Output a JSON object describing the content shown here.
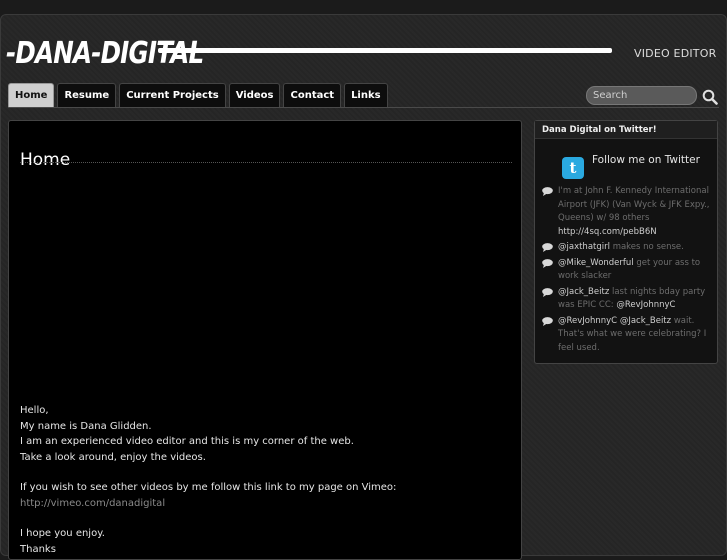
{
  "header": {
    "logo_text": "-DANA-DIGITAL",
    "tagline": "VIDEO EDITOR"
  },
  "nav": {
    "tabs": [
      "Home",
      "Resume",
      "Current Projects",
      "Videos",
      "Contact",
      "Links"
    ],
    "active": "Home"
  },
  "search": {
    "placeholder": "Search"
  },
  "main": {
    "title": "Home",
    "paragraphs": {
      "p1": [
        "Hello,",
        "My name is Dana Glidden.",
        "I am an experienced video editor and this is my corner of the web.",
        "Take a look around, enjoy the videos."
      ],
      "p2_text": "If you wish to see other videos by me follow this link to my page on Vimeo:",
      "p2_link": "http://vimeo.com/danadigital",
      "p3": "I hope you enjoy.",
      "p4": "Thanks"
    }
  },
  "sidebar": {
    "title": "Dana Digital on Twitter!",
    "follow_label": "Follow me on Twitter",
    "tweets": [
      {
        "mention": "",
        "text": "I'm at John F. Kennedy International Airport (JFK) (Van Wyck & JFK Expy., Queens) w/ 98 others",
        "link": "http://4sq.com/pebB6N"
      },
      {
        "mention": "@jaxthatgirl",
        "text": "makes no sense.",
        "link": ""
      },
      {
        "mention": "@Mike_Wonderful",
        "text": "get your ass to work slacker",
        "link": ""
      },
      {
        "mention": "@Jack_Beitz",
        "text": "last nights bday party was EPIC CC:",
        "link": "@RevJohnnyC"
      },
      {
        "mention": "@RevJohnnyC @Jack_Beitz",
        "text": "wait. That's what we were celebrating? I feel used.",
        "link": ""
      }
    ]
  },
  "colors": {
    "background": "#262626",
    "content_bg": "#000000",
    "twitter_blue": "#2aa9e0",
    "link_gray": "#8a8a8a"
  },
  "icons": {
    "search": "search-icon",
    "twitter": "twitter-bird-icon",
    "tweet": "speech-bubble-icon"
  }
}
